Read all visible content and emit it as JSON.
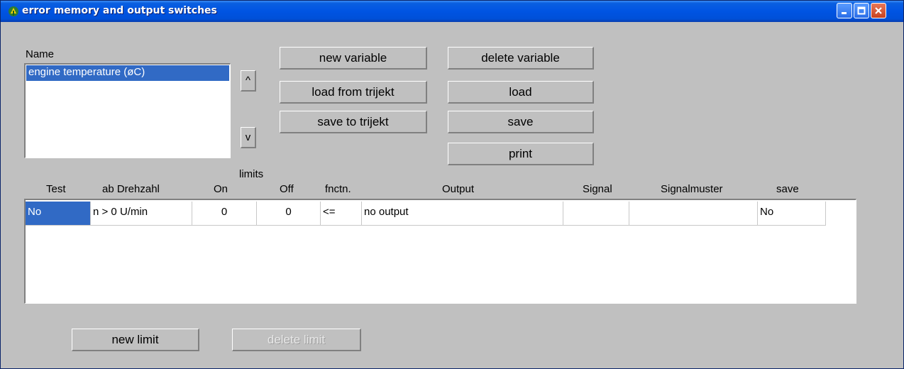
{
  "window": {
    "title": "error memory and output switches"
  },
  "name_section": {
    "label": "Name",
    "items": [
      "engine temperature (øC)"
    ]
  },
  "move_buttons": {
    "up": "^",
    "down": "v"
  },
  "buttons": {
    "new_variable": "new variable",
    "load_from_trijekt": "load from trijekt",
    "save_to_trijekt": "save to trijekt",
    "delete_variable": "delete variable",
    "load": "load",
    "save": "save",
    "print": "print"
  },
  "limits_label": "limits",
  "table": {
    "columns": [
      "Test",
      "ab Drehzahl",
      "On",
      "Off",
      "fnctn.",
      "Output",
      "Signal",
      "Signalmuster",
      "save"
    ],
    "rows": [
      {
        "test": "No",
        "ab_drehzahl": "n > 0 U/min",
        "on": "0",
        "off": "0",
        "fnctn": "<=",
        "output": "no output",
        "signal": "",
        "signalmuster": "",
        "save": "No"
      }
    ]
  },
  "bottom_buttons": {
    "new_limit": "new limit",
    "delete_limit": "delete limit"
  },
  "colors": {
    "titlebar": "#0054e3",
    "selection": "#316ac5",
    "face": "#c0c0c0"
  }
}
